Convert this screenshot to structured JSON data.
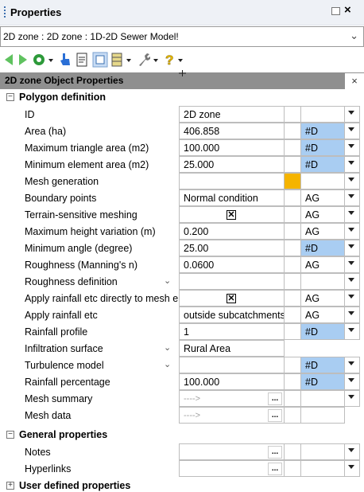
{
  "window": {
    "title": "Properties",
    "restore_icon": "restore-icon",
    "close_icon": "close-icon"
  },
  "selector": {
    "value": "2D zone : 2D zone : 1D-2D Sewer Model!"
  },
  "toolbar": {
    "buttons": [
      "back-arrow-icon",
      "forward-arrow-icon",
      "wheel-icon",
      "hand-pointer-icon",
      "document-icon",
      "layout-icon",
      "columns-icon",
      "wrench-icon",
      "help-icon"
    ]
  },
  "object_panel": {
    "title": "2D zone Object Properties"
  },
  "sections": {
    "polygon": "Polygon definition",
    "general": "General properties",
    "user": "User defined properties"
  },
  "properties": [
    {
      "name": "ID",
      "value": "2D zone",
      "flag": ""
    },
    {
      "name": "Area (ha)",
      "value": "406.858",
      "flag": "#D"
    },
    {
      "name": "Maximum triangle area (m2)",
      "value": "100.000",
      "flag": "#D"
    },
    {
      "name": "Minimum element area (m2)",
      "value": "25.000",
      "flag": "#D"
    },
    {
      "name": "Mesh generation",
      "value": "",
      "flag": ""
    },
    {
      "name": "Boundary points",
      "value": "Normal condition",
      "flag": "AG"
    },
    {
      "name": "Terrain-sensitive meshing",
      "value": "☒",
      "flag": "AG"
    },
    {
      "name": "Maximum height variation (m)",
      "value": "0.200",
      "flag": "AG"
    },
    {
      "name": "Minimum angle (degree)",
      "value": "25.00",
      "flag": "#D"
    },
    {
      "name": "Roughness (Manning's n)",
      "value": "0.0600",
      "flag": "AG"
    },
    {
      "name": "Roughness definition",
      "value": "",
      "flag": ""
    },
    {
      "name": "Apply rainfall etc directly to mesh elements",
      "value": "☒",
      "flag": "AG"
    },
    {
      "name": "Apply rainfall etc",
      "value": "outside subcatchments",
      "flag": "AG"
    },
    {
      "name": "Rainfall profile",
      "value": "1",
      "flag": "#D"
    },
    {
      "name": "Infiltration surface",
      "value": "Rural Area",
      "flag": ""
    },
    {
      "name": "Turbulence model",
      "value": "",
      "flag": "#D"
    },
    {
      "name": "Rainfall percentage",
      "value": "100.000",
      "flag": "#D"
    },
    {
      "name": "Mesh summary",
      "value": "---->",
      "flag": ""
    },
    {
      "name": "Mesh data",
      "value": "---->",
      "flag": ""
    }
  ],
  "general_properties": [
    {
      "name": "Notes",
      "value": ""
    },
    {
      "name": "Hyperlinks",
      "value": ""
    }
  ],
  "ellipsis": "...",
  "colors": {
    "flag_blue": "#a9cdf2",
    "mesh_orange": "#f5b400",
    "header_grey": "#8f8f8f"
  }
}
